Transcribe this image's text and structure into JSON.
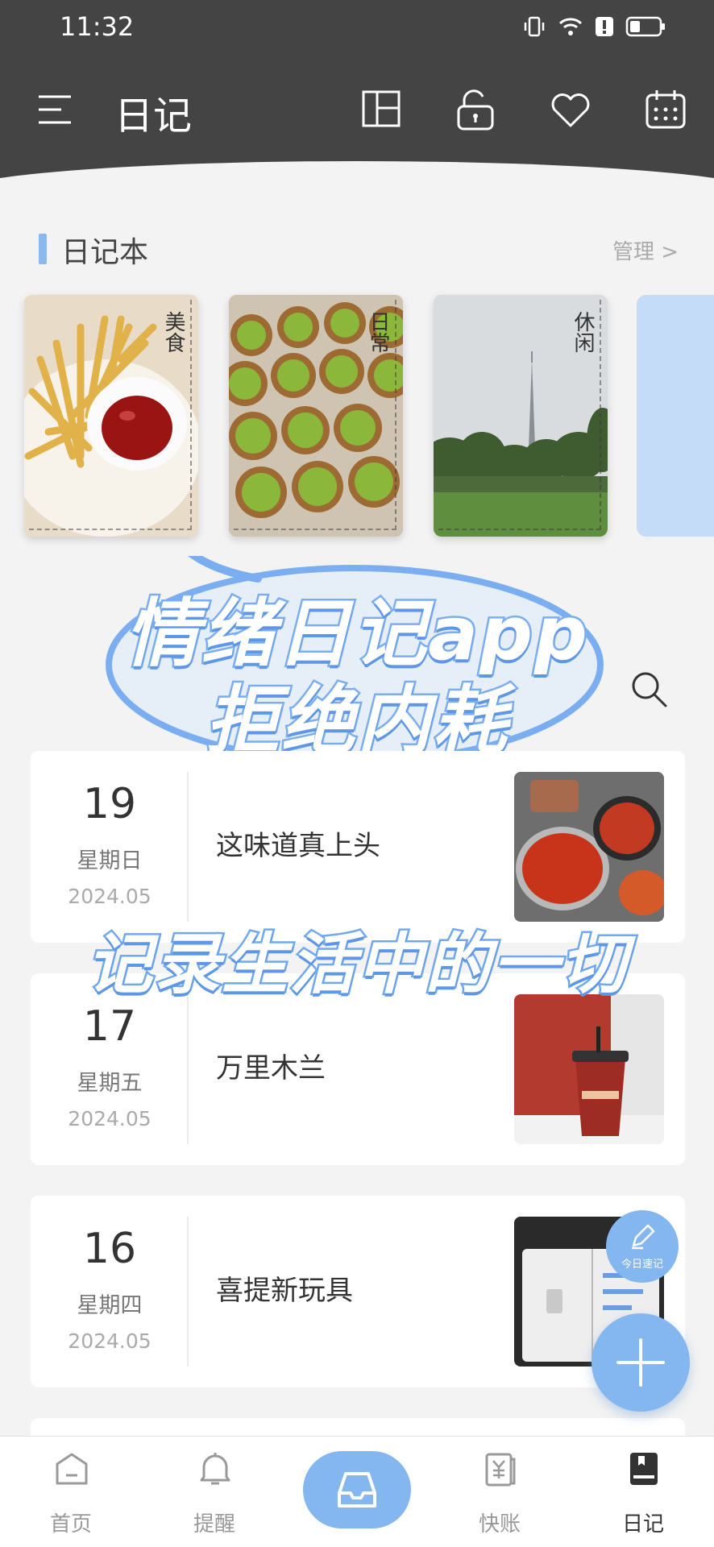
{
  "status_bar": {
    "time": "11:32"
  },
  "header": {
    "title": "日记"
  },
  "notebooks": {
    "section_title": "日记本",
    "manage_label": "管理 >",
    "items": [
      {
        "label": "美食"
      },
      {
        "label": "日常"
      },
      {
        "label": "休闲"
      }
    ]
  },
  "promo": {
    "line1": "情绪日记app",
    "line2": "拒绝内耗",
    "line3": "记录生活中的一切"
  },
  "entries": [
    {
      "day": "19",
      "weekday": "星期日",
      "date": "2024.05",
      "title": "这味道真上头"
    },
    {
      "day": "17",
      "weekday": "星期五",
      "date": "2024.05",
      "title": "万里木兰"
    },
    {
      "day": "16",
      "weekday": "星期四",
      "date": "2024.05",
      "title": "喜提新玩具"
    }
  ],
  "fab": {
    "quick_label": "今日速记"
  },
  "bottom_nav": [
    {
      "label": "首页"
    },
    {
      "label": "提醒"
    },
    {
      "label": "快账"
    },
    {
      "label": "日记"
    }
  ],
  "colors": {
    "accent": "#84b6ef",
    "header": "#444444"
  }
}
